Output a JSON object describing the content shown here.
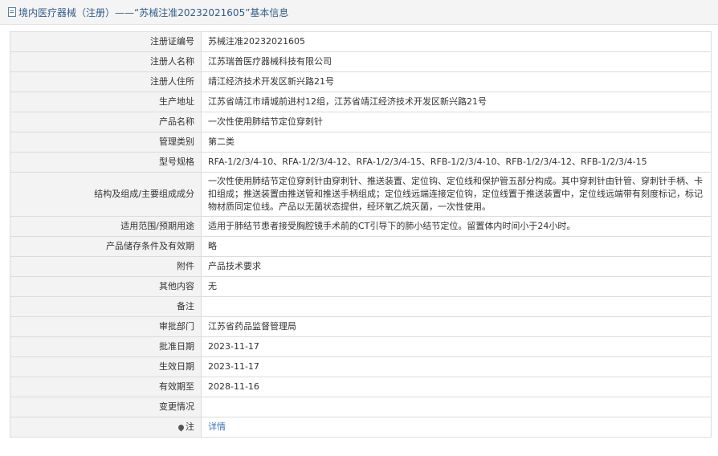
{
  "header": {
    "icon": "document-icon",
    "title": "境内医疗器械（注册）——“苏械注准20232021605”基本信息"
  },
  "rows": [
    {
      "label": "注册证编号",
      "value": "苏械注准20232021605"
    },
    {
      "label": "注册人名称",
      "value": "江苏瑞普医疗器械科技有限公司"
    },
    {
      "label": "注册人住所",
      "value": "靖江经济技术开发区新兴路21号"
    },
    {
      "label": "生产地址",
      "value": "江苏省靖江市靖城前进村12组，江苏省靖江经济技术开发区新兴路21号"
    },
    {
      "label": "产品名称",
      "value": "一次性使用肺结节定位穿刺针"
    },
    {
      "label": "管理类别",
      "value": "第二类"
    },
    {
      "label": "型号规格",
      "value": "RFA-1/2/3/4-10、RFA-1/2/3/4-12、RFA-1/2/3/4-15、RFB-1/2/3/4-10、RFB-1/2/3/4-12、RFB-1/2/3/4-15"
    },
    {
      "label": "结构及组成/主要组成成分",
      "value": "一次性使用肺结节定位穿刺针由穿刺针、推送装置、定位钩、定位线和保护管五部分构成。其中穿刺针由针管、穿刺针手柄、卡扣组成；推送装置由推送管和推送手柄组成；定位线远端连接定位钩，定位线置于推送装置中，定位线远端带有刻度标记，标记物材质同定位线。产品以无菌状态提供，经环氧乙烷灭菌，一次性使用。"
    },
    {
      "label": "适用范围/预期用途",
      "value": "适用于肺结节患者接受胸腔镜手术前的CT引导下的肺小结节定位。留置体内时间小于24小时。"
    },
    {
      "label": "产品储存条件及有效期",
      "value": "略"
    },
    {
      "label": "附件",
      "value": "产品技术要求"
    },
    {
      "label": "其他内容",
      "value": "无"
    },
    {
      "label": "备注",
      "value": ""
    },
    {
      "label": "审批部门",
      "value": "江苏省药品监督管理局"
    },
    {
      "label": "批准日期",
      "value": "2023-11-17"
    },
    {
      "label": "生效日期",
      "value": "2023-11-17"
    },
    {
      "label": "有效期至",
      "value": "2028-11-16"
    },
    {
      "label": "变更情况",
      "value": ""
    }
  ],
  "note": {
    "icon": "pin-icon",
    "label": "注",
    "link_text": "详情",
    "link_color": "#3b73b9"
  }
}
